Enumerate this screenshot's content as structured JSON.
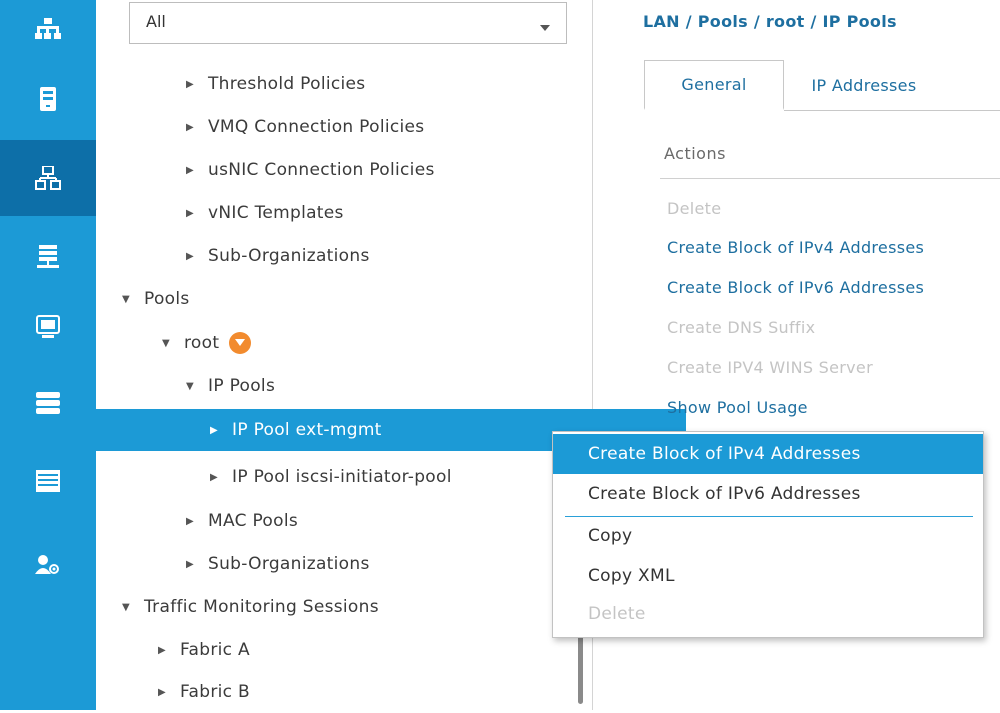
{
  "rail": {
    "items": [
      {
        "icon": "equipment-icon",
        "active": false
      },
      {
        "icon": "servers-icon",
        "active": false
      },
      {
        "icon": "lan-icon",
        "active": true
      },
      {
        "icon": "san-icon",
        "active": false
      },
      {
        "icon": "vm-icon",
        "active": false
      },
      {
        "icon": "storage-icon",
        "active": false
      },
      {
        "icon": "chassis-icon",
        "active": false
      },
      {
        "icon": "admin-icon",
        "active": false
      }
    ]
  },
  "nav": {
    "filter": {
      "value": "All"
    },
    "tree": [
      {
        "label": "Threshold Policies",
        "expanded": false
      },
      {
        "label": "VMQ Connection Policies",
        "expanded": false
      },
      {
        "label": "usNIC Connection Policies",
        "expanded": false
      },
      {
        "label": "vNIC Templates",
        "expanded": false
      },
      {
        "label": "Sub-Organizations",
        "expanded": false
      },
      {
        "label": "Pools",
        "expanded": true
      },
      {
        "label": "root",
        "expanded": true
      },
      {
        "label": "IP Pools",
        "expanded": true
      },
      {
        "label": "IP Pool ext-mgmt",
        "expanded": false,
        "selected": true
      },
      {
        "label": "IP Pool iscsi-initiator-pool",
        "expanded": false
      },
      {
        "label": "MAC Pools",
        "expanded": false
      },
      {
        "label": "Sub-Organizations",
        "expanded": false
      },
      {
        "label": "Traffic Monitoring Sessions",
        "expanded": true
      },
      {
        "label": "Fabric A",
        "expanded": false
      },
      {
        "label": "Fabric B",
        "expanded": false
      }
    ]
  },
  "content": {
    "breadcrumb": "LAN / Pools / root / IP Pools",
    "tabs": [
      {
        "label": "General",
        "active": true
      },
      {
        "label": "IP Addresses",
        "active": false
      }
    ],
    "actions_heading": "Actions",
    "actions": [
      {
        "label": "Delete",
        "enabled": false
      },
      {
        "label": "Create Block of IPv4 Addresses",
        "enabled": true
      },
      {
        "label": "Create Block of IPv6 Addresses",
        "enabled": true
      },
      {
        "label": "Create DNS Suffix",
        "enabled": false
      },
      {
        "label": "Create IPV4 WINS Server",
        "enabled": false
      },
      {
        "label": "Show Pool Usage",
        "enabled": true
      }
    ]
  },
  "context_menu": {
    "items": [
      {
        "label": "Create Block of IPv4 Addresses",
        "enabled": true,
        "highlighted": true
      },
      {
        "label": "Create Block of IPv6 Addresses",
        "enabled": true,
        "highlighted": false
      },
      {
        "label": "Copy",
        "enabled": true,
        "highlighted": false
      },
      {
        "label": "Copy XML",
        "enabled": true,
        "highlighted": false
      },
      {
        "label": "Delete",
        "enabled": false,
        "highlighted": false
      }
    ]
  },
  "colors": {
    "accent": "#1c9ad6",
    "accent_dark": "#0d6fa8",
    "link": "#1e6fa0",
    "disabled_text": "#c4c4c4",
    "org_badge": "#f28b2e"
  }
}
